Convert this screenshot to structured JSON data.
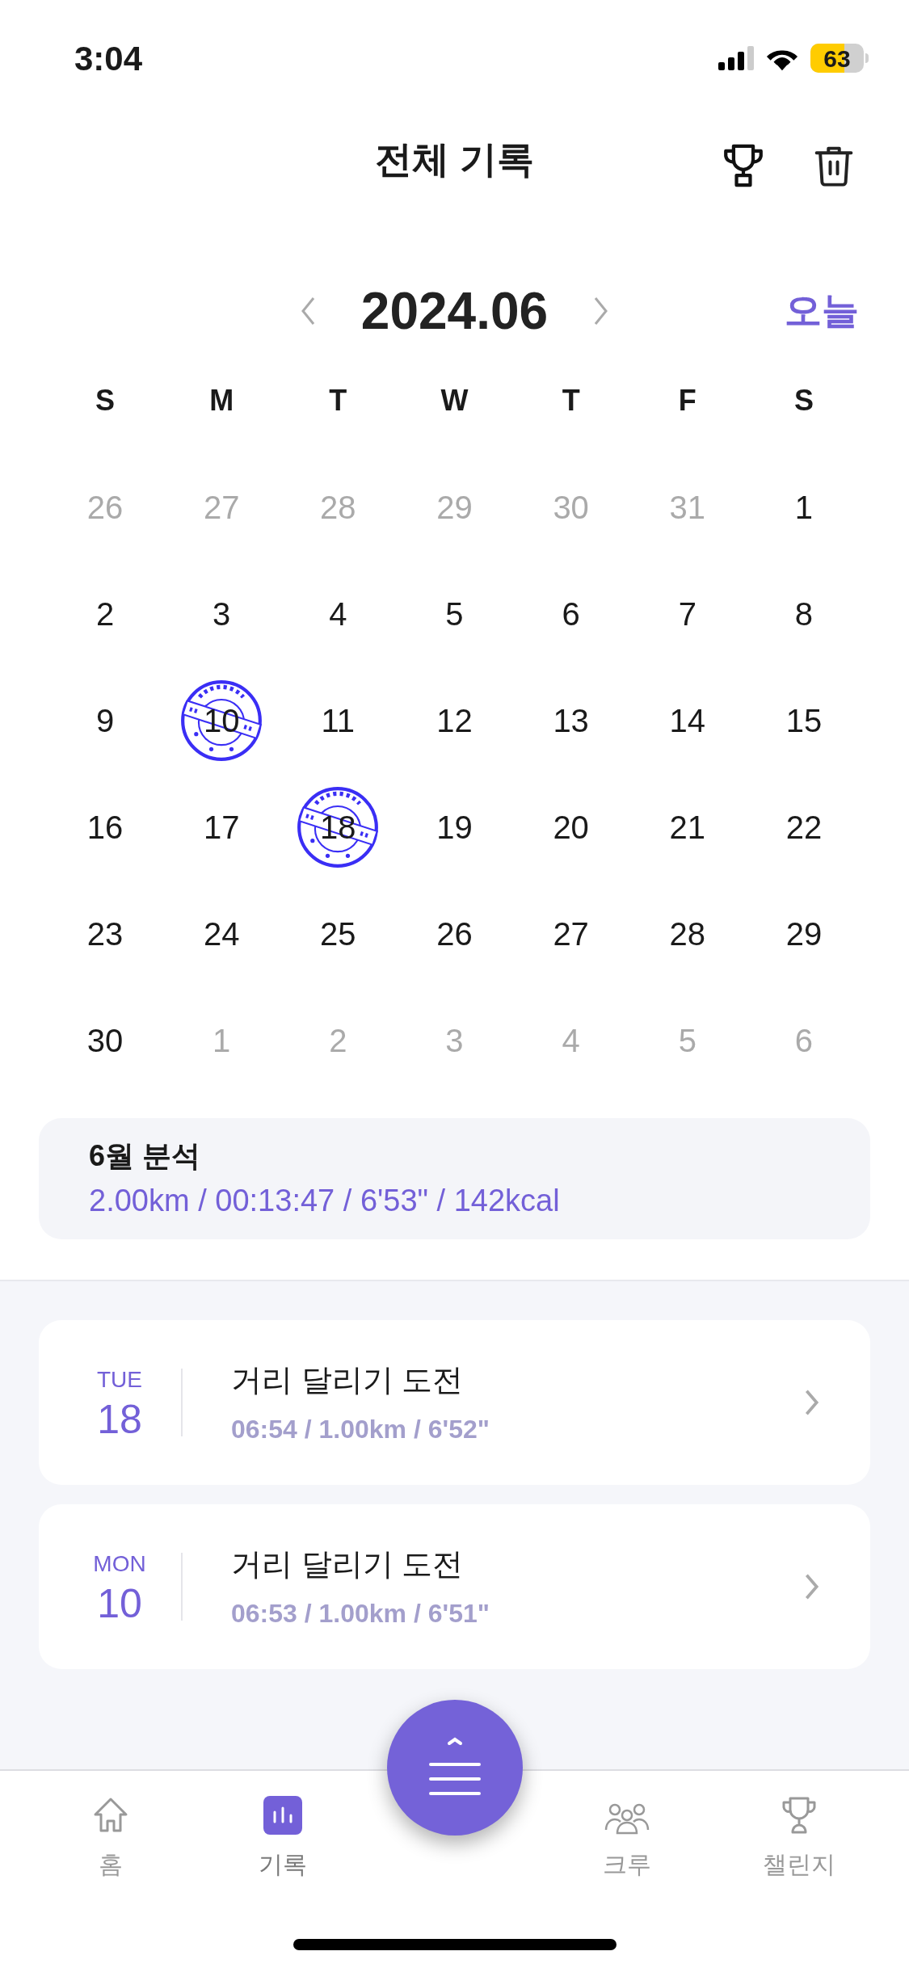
{
  "status_bar": {
    "time": "3:04",
    "battery": "63"
  },
  "header": {
    "title": "전체 기록"
  },
  "calendar": {
    "month": "2024.06",
    "today_button": "오늘",
    "weekdays": [
      "S",
      "M",
      "T",
      "W",
      "T",
      "F",
      "S"
    ],
    "days": [
      {
        "label": "26",
        "muted": true,
        "stamped": false
      },
      {
        "label": "27",
        "muted": true,
        "stamped": false
      },
      {
        "label": "28",
        "muted": true,
        "stamped": false
      },
      {
        "label": "29",
        "muted": true,
        "stamped": false
      },
      {
        "label": "30",
        "muted": true,
        "stamped": false
      },
      {
        "label": "31",
        "muted": true,
        "stamped": false
      },
      {
        "label": "1",
        "muted": false,
        "stamped": false
      },
      {
        "label": "2",
        "muted": false,
        "stamped": false
      },
      {
        "label": "3",
        "muted": false,
        "stamped": false
      },
      {
        "label": "4",
        "muted": false,
        "stamped": false
      },
      {
        "label": "5",
        "muted": false,
        "stamped": false
      },
      {
        "label": "6",
        "muted": false,
        "stamped": false
      },
      {
        "label": "7",
        "muted": false,
        "stamped": false
      },
      {
        "label": "8",
        "muted": false,
        "stamped": false
      },
      {
        "label": "9",
        "muted": false,
        "stamped": false
      },
      {
        "label": "10",
        "muted": false,
        "stamped": true
      },
      {
        "label": "11",
        "muted": false,
        "stamped": false
      },
      {
        "label": "12",
        "muted": false,
        "stamped": false
      },
      {
        "label": "13",
        "muted": false,
        "stamped": false
      },
      {
        "label": "14",
        "muted": false,
        "stamped": false
      },
      {
        "label": "15",
        "muted": false,
        "stamped": false
      },
      {
        "label": "16",
        "muted": false,
        "stamped": false
      },
      {
        "label": "17",
        "muted": false,
        "stamped": false
      },
      {
        "label": "18",
        "muted": false,
        "stamped": true
      },
      {
        "label": "19",
        "muted": false,
        "stamped": false
      },
      {
        "label": "20",
        "muted": false,
        "stamped": false
      },
      {
        "label": "21",
        "muted": false,
        "stamped": false
      },
      {
        "label": "22",
        "muted": false,
        "stamped": false
      },
      {
        "label": "23",
        "muted": false,
        "stamped": false
      },
      {
        "label": "24",
        "muted": false,
        "stamped": false
      },
      {
        "label": "25",
        "muted": false,
        "stamped": false
      },
      {
        "label": "26",
        "muted": false,
        "stamped": false
      },
      {
        "label": "27",
        "muted": false,
        "stamped": false
      },
      {
        "label": "28",
        "muted": false,
        "stamped": false
      },
      {
        "label": "29",
        "muted": false,
        "stamped": false
      },
      {
        "label": "30",
        "muted": false,
        "stamped": false
      },
      {
        "label": "1",
        "muted": true,
        "stamped": false
      },
      {
        "label": "2",
        "muted": true,
        "stamped": false
      },
      {
        "label": "3",
        "muted": true,
        "stamped": false
      },
      {
        "label": "4",
        "muted": true,
        "stamped": false
      },
      {
        "label": "5",
        "muted": true,
        "stamped": false
      },
      {
        "label": "6",
        "muted": true,
        "stamped": false
      }
    ]
  },
  "summary": {
    "title": "6월 분석",
    "stats": "2.00km / 00:13:47 / 6'53\" / 142kcal"
  },
  "records": [
    {
      "weekday": "TUE",
      "day": "18",
      "title": "거리 달리기 도전",
      "details": "06:54 / 1.00km / 6'52\""
    },
    {
      "weekday": "MON",
      "day": "10",
      "title": "거리 달리기 도전",
      "details": "06:53 / 1.00km / 6'51\""
    }
  ],
  "tab_bar": [
    {
      "kind": "home",
      "label": "홈",
      "selected": false
    },
    {
      "kind": "records",
      "label": "기록",
      "selected": true
    },
    {
      "kind": "fab"
    },
    {
      "kind": "crew",
      "label": "크루",
      "selected": false
    },
    {
      "kind": "challenge",
      "label": "챌린지",
      "selected": false
    }
  ]
}
